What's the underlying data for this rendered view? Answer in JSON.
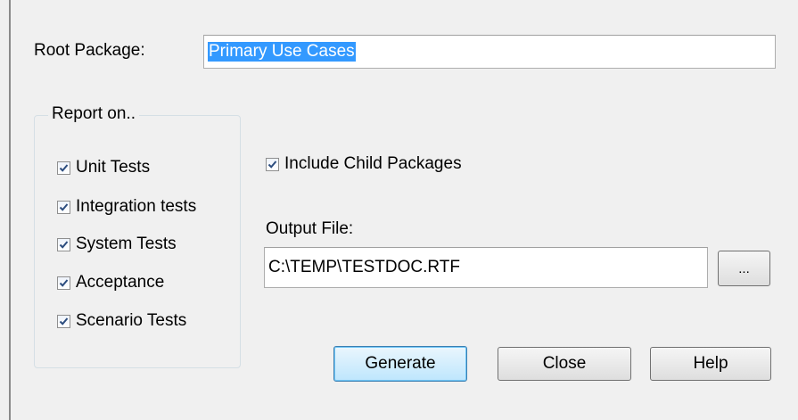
{
  "root_package": {
    "label": "Root Package:",
    "value": "Primary Use Cases"
  },
  "report_on": {
    "title": "Report on..",
    "items": [
      {
        "label": "Unit Tests",
        "checked": true
      },
      {
        "label": "Integration tests",
        "checked": true
      },
      {
        "label": "System Tests",
        "checked": true
      },
      {
        "label": "Acceptance",
        "checked": true
      },
      {
        "label": "Scenario Tests",
        "checked": true
      }
    ]
  },
  "include_child": {
    "label": "Include Child Packages",
    "checked": true
  },
  "output_file": {
    "label": "Output File:",
    "value": "C:\\TEMP\\TESTDOC.RTF",
    "browse_label": "..."
  },
  "buttons": {
    "generate": "Generate",
    "close": "Close",
    "help": "Help"
  },
  "colors": {
    "background": "#f0f0f0",
    "selection": "#3399ff",
    "default_button_border": "#3c7fb1"
  }
}
